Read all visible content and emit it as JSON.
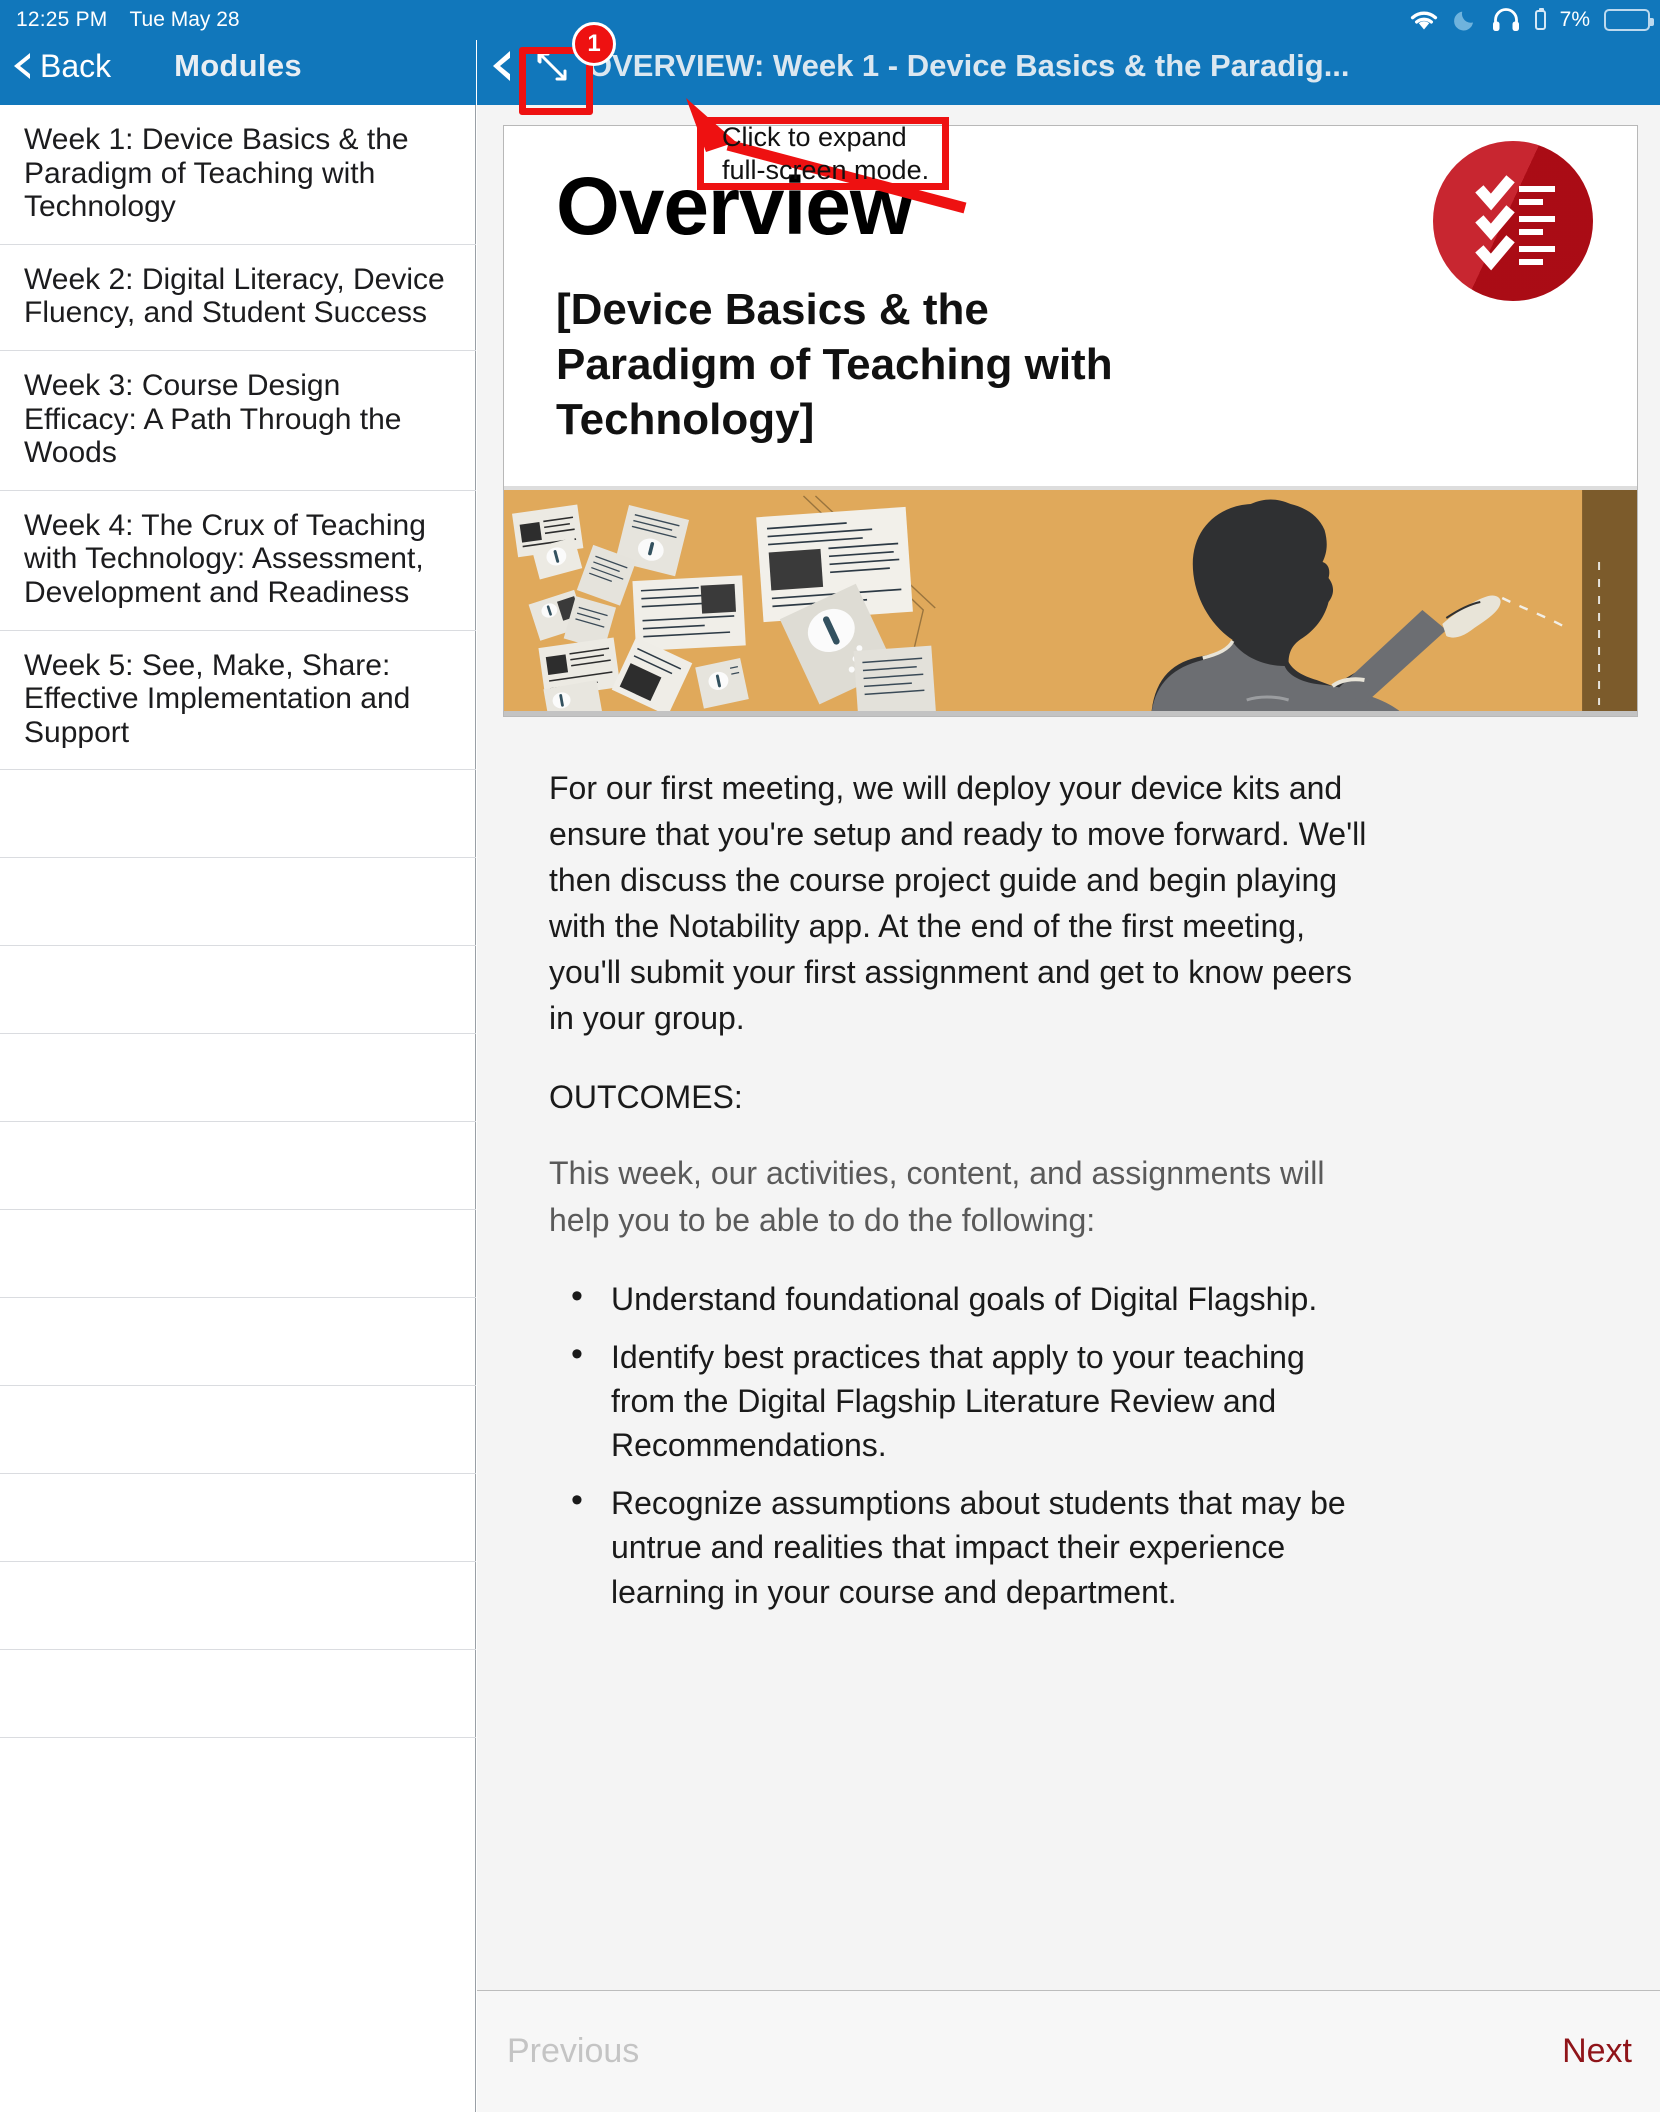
{
  "status_bar": {
    "time": "12:25 PM",
    "date": "Tue May 28",
    "battery_percent": "7%",
    "icons": [
      "wifi-icon",
      "moon-do-not-disturb-icon",
      "headphones-icon",
      "small-battery-icon",
      "battery-icon"
    ],
    "battery_low_color": "#e03b34",
    "bar_color": "#1177bb"
  },
  "left_pane": {
    "back_label": "Back",
    "title": "Modules",
    "items": [
      "Week 1: Device Basics & the Paradigm of Teaching with Technology",
      "Week 2: Digital Literacy, Device Fluency, and Student Success",
      "Week 3: Course Design Efficacy: A Path Through the Woods",
      "Week 4: The Crux of Teaching with Technology: Assessment, Development and Readiness",
      "Week 5: See, Make, Share: Effective Implementation and Support"
    ],
    "empty_row_count": 11
  },
  "right_pane": {
    "title": "OVERVIEW: Week 1 - Device Basics & the Paradig...",
    "back_icon": "chevron-left-icon",
    "expand_icon": "expand-fullscreen-icon"
  },
  "slide": {
    "heading": "Overview",
    "subheading": "[Device Basics & the Paradigm of Teaching with Technology]",
    "badge_icon": "checklist-circle-icon",
    "badge_color": "#c20d18",
    "image_alt": "teacher-writing-on-wall-illustration",
    "image_bg_color": "#e0a95b"
  },
  "body": {
    "paragraph": "For our first meeting, we will deploy your device kits and ensure that you're setup and ready to move forward. We'll then discuss the course project guide and begin playing with the Notability app. At the end of the first meeting, you'll submit your first assignment and get to know peers in your group.",
    "outcomes_label": "OUTCOMES:",
    "outcomes_intro": "This week, our activities, content, and assignments will help you to be able to do the following:",
    "bullets": [
      "Understand foundational goals of Digital Flagship.",
      "Identify best practices that apply to your teaching from the Digital Flagship Literature Review and Recommendations.",
      "Recognize assumptions about students that may be untrue and realities that impact their experience learning in your course and department."
    ]
  },
  "pager": {
    "previous_label": "Previous",
    "next_label": "Next",
    "next_color": "#8f1419",
    "previous_color": "#c4c4c4"
  },
  "annotation": {
    "badge_number": "1",
    "callout_line1": "Click to expand",
    "callout_line2": "full-screen mode.",
    "accent_color": "#ee1111"
  }
}
